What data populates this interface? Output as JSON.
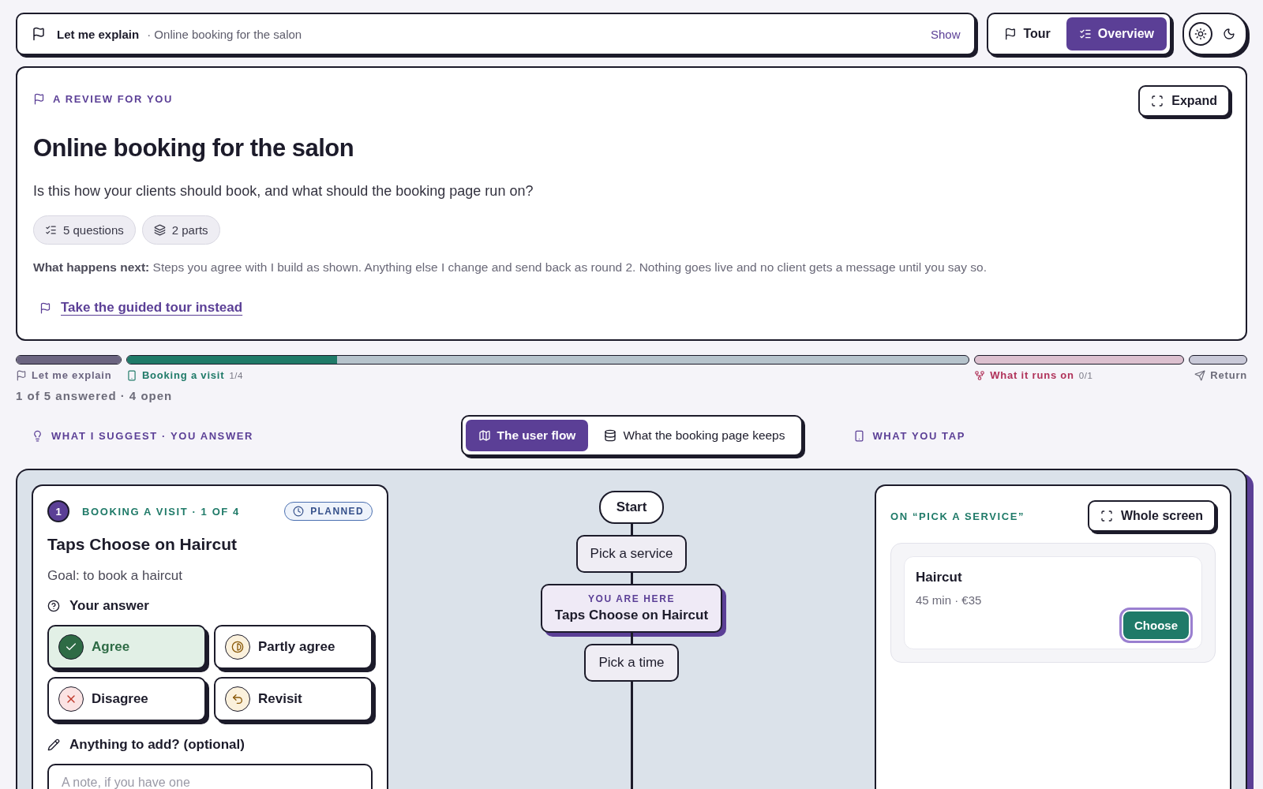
{
  "topbar": {
    "title": "Let me explain",
    "subtitle": "· Online booking for the salon",
    "show_link": "Show"
  },
  "view_switch": [
    {
      "kind": "tour",
      "label": "Tour",
      "selected": false
    },
    {
      "kind": "overview",
      "label": "Overview",
      "selected": true
    }
  ],
  "theme_toggle": [
    {
      "kind": "light",
      "selected": true
    },
    {
      "kind": "dark",
      "selected": false
    }
  ],
  "hero": {
    "eyebrow": "A REVIEW FOR YOU",
    "expand_button": "Expand",
    "title": "Online booking for the salon",
    "question": "Is this how your clients should book, and what should the booking page run on?",
    "chips": [
      {
        "kind": "questions",
        "label": "5 questions"
      },
      {
        "kind": "parts",
        "label": "2 parts"
      }
    ],
    "next_steps": "**What happens next:** Steps you agree with I build as shown. Anything else I change and send back as round 2. Nothing goes live and no client gets a message until you say so.",
    "tour_link": "Take the guided tour instead"
  },
  "progress": {
    "segments": [
      {
        "kind": "intro",
        "label": "Let me explain",
        "level": 1,
        "color": "#6b6480"
      },
      {
        "kind": "phone",
        "label": "Booking a visit",
        "count": "1/4",
        "level": 0.25,
        "color": "#1f7a68"
      },
      {
        "kind": "fork",
        "label": "What it runs on",
        "count": "0/1",
        "level": 0,
        "color": "#b0325a"
      },
      {
        "kind": "send",
        "label": "Return",
        "level": 0,
        "color": "#6b6a78"
      }
    ],
    "summary": "1 of 5 answered · 4 open"
  },
  "sections": {
    "left_heading": "WHAT I SUGGEST · YOU ANSWER",
    "tabs": [
      {
        "kind": "map",
        "label": "The user flow",
        "selected": true
      },
      {
        "kind": "database",
        "label": "What the booking page keeps",
        "selected": false
      }
    ],
    "right_heading": "WHAT YOU TAP"
  },
  "question_card": {
    "number": "1",
    "eyebrow": "BOOKING A VISIT · 1 OF 4",
    "status": "PLANNED",
    "title": "Taps Choose on Haircut",
    "goal": "Goal: to book a haircut",
    "answer_label": "Your answer",
    "options": [
      {
        "kind": "agree",
        "label": "Agree",
        "selected": true
      },
      {
        "kind": "partly",
        "label": "Partly agree",
        "selected": false
      },
      {
        "kind": "disagree",
        "label": "Disagree",
        "selected": false
      },
      {
        "kind": "revisit",
        "label": "Revisit",
        "selected": false
      }
    ],
    "note_label": "Anything to add? (optional)",
    "note_placeholder": "A note, if you have one"
  },
  "flow": {
    "nodes": [
      {
        "kind": "start",
        "label": "Start"
      },
      {
        "kind": "step",
        "label": "Pick a service"
      },
      {
        "kind": "current",
        "eyebrow": "YOU ARE HERE",
        "label": "Taps Choose on Haircut"
      },
      {
        "kind": "step",
        "label": "Pick a time"
      }
    ]
  },
  "preview": {
    "heading": "ON “PICK A SERVICE”",
    "whole_screen_button": "Whole screen",
    "service": {
      "name": "Haircut",
      "details": "45 min · €35",
      "button": "Choose"
    }
  }
}
